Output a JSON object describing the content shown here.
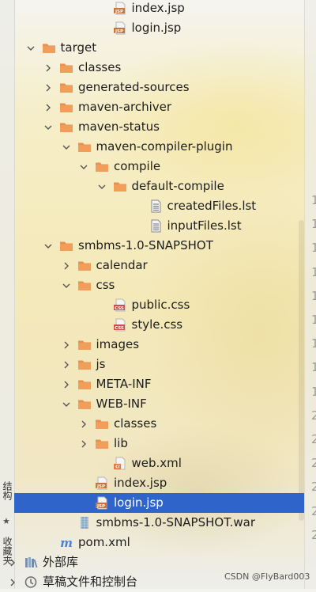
{
  "tree": {
    "items": [
      {
        "label": "index.jsp",
        "icon": "jsp-file-icon",
        "depth": 5,
        "toggle": "none"
      },
      {
        "label": "login.jsp",
        "icon": "jsp-file-icon",
        "depth": 5,
        "toggle": "none"
      },
      {
        "label": "target",
        "icon": "folder-icon",
        "depth": 1,
        "toggle": "expanded"
      },
      {
        "label": "classes",
        "icon": "folder-icon",
        "depth": 2,
        "toggle": "collapsed"
      },
      {
        "label": "generated-sources",
        "icon": "folder-icon",
        "depth": 2,
        "toggle": "collapsed"
      },
      {
        "label": "maven-archiver",
        "icon": "folder-icon",
        "depth": 2,
        "toggle": "collapsed"
      },
      {
        "label": "maven-status",
        "icon": "folder-icon",
        "depth": 2,
        "toggle": "expanded"
      },
      {
        "label": "maven-compiler-plugin",
        "icon": "folder-icon",
        "depth": 3,
        "toggle": "expanded"
      },
      {
        "label": "compile",
        "icon": "folder-icon",
        "depth": 4,
        "toggle": "expanded"
      },
      {
        "label": "default-compile",
        "icon": "folder-icon",
        "depth": 5,
        "toggle": "expanded"
      },
      {
        "label": "createdFiles.lst",
        "icon": "text-file-icon",
        "depth": 7,
        "toggle": "none"
      },
      {
        "label": "inputFiles.lst",
        "icon": "text-file-icon",
        "depth": 7,
        "toggle": "none"
      },
      {
        "label": "smbms-1.0-SNAPSHOT",
        "icon": "folder-icon",
        "depth": 2,
        "toggle": "expanded"
      },
      {
        "label": "calendar",
        "icon": "folder-icon",
        "depth": 3,
        "toggle": "collapsed"
      },
      {
        "label": "css",
        "icon": "folder-icon",
        "depth": 3,
        "toggle": "expanded"
      },
      {
        "label": "public.css",
        "icon": "css-file-icon",
        "depth": 5,
        "toggle": "none"
      },
      {
        "label": "style.css",
        "icon": "css-file-icon",
        "depth": 5,
        "toggle": "none"
      },
      {
        "label": "images",
        "icon": "folder-icon",
        "depth": 3,
        "toggle": "collapsed"
      },
      {
        "label": "js",
        "icon": "folder-icon",
        "depth": 3,
        "toggle": "collapsed"
      },
      {
        "label": "META-INF",
        "icon": "folder-icon",
        "depth": 3,
        "toggle": "collapsed"
      },
      {
        "label": "WEB-INF",
        "icon": "folder-icon",
        "depth": 3,
        "toggle": "expanded"
      },
      {
        "label": "classes",
        "icon": "folder-icon",
        "depth": 4,
        "toggle": "collapsed"
      },
      {
        "label": "lib",
        "icon": "folder-icon",
        "depth": 4,
        "toggle": "collapsed"
      },
      {
        "label": "web.xml",
        "icon": "xml-file-icon",
        "depth": 5,
        "toggle": "none"
      },
      {
        "label": "index.jsp",
        "icon": "jsp-file-icon",
        "depth": 4,
        "toggle": "none"
      },
      {
        "label": "login.jsp",
        "icon": "jsp-file-icon",
        "depth": 4,
        "toggle": "none",
        "selected": true
      },
      {
        "label": "smbms-1.0-SNAPSHOT.war",
        "icon": "war-archive-icon",
        "depth": 3,
        "toggle": "none"
      },
      {
        "label": "pom.xml",
        "icon": "maven-file-icon",
        "depth": 2,
        "toggle": "none"
      },
      {
        "label": "外部库",
        "icon": "library-icon",
        "depth": 0,
        "toggle": "collapsed"
      },
      {
        "label": "草稿文件和控制台",
        "icon": "scratches-icon",
        "depth": 0,
        "toggle": "collapsed"
      }
    ]
  },
  "side_tabs": {
    "structure": "结构",
    "favorites": "收藏夹"
  },
  "gutter_numbers": [
    "1",
    "1",
    "1",
    "1",
    "1",
    "1",
    "1",
    "1",
    "1",
    "2",
    "2",
    "2",
    "2",
    "2",
    "2"
  ],
  "watermark": "CSDN @FlyBard003",
  "colors": {
    "selection": "#2f65ca",
    "folder": "#e8914f",
    "jsp_badge": "#c9743a",
    "css_badge": "#d24d4a"
  }
}
